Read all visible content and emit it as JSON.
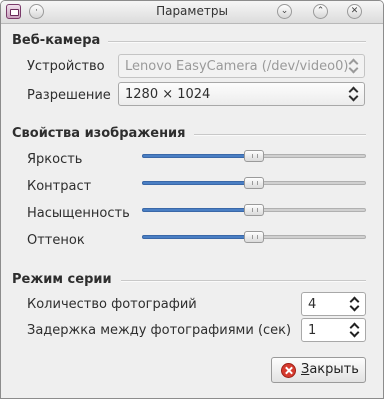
{
  "window": {
    "title": "Параметры",
    "icons": {
      "app": "app-icon",
      "shade": "shade-icon",
      "minimize": "chevron-down-icon",
      "maximize": "chevron-up-icon",
      "close": "close-icon"
    }
  },
  "webcam": {
    "section_title": "Веб-камера",
    "device_label": "Устройство",
    "device_value": "Lenovo EasyCamera (/dev/video0)",
    "resolution_label": "Разрешение",
    "resolution_value": "1280 × 1024"
  },
  "image_properties": {
    "section_title": "Свойства изображения",
    "brightness_label": "Яркость",
    "brightness_value": 0.5,
    "contrast_label": "Контраст",
    "contrast_value": 0.5,
    "saturation_label": "Насыщенность",
    "saturation_value": 0.5,
    "hue_label": "Оттенок",
    "hue_value": 0.5
  },
  "burst_mode": {
    "section_title": "Режим серии",
    "count_label": "Количество фотографий",
    "count_value": "4",
    "delay_label": "Задержка между фотографиями (сек)",
    "delay_value": "1"
  },
  "footer": {
    "close_label_underlined": "З",
    "close_label_rest": "акрыть"
  },
  "colors": {
    "slider_fill": "#4a7fc4",
    "close_icon": "#d63b2f"
  }
}
